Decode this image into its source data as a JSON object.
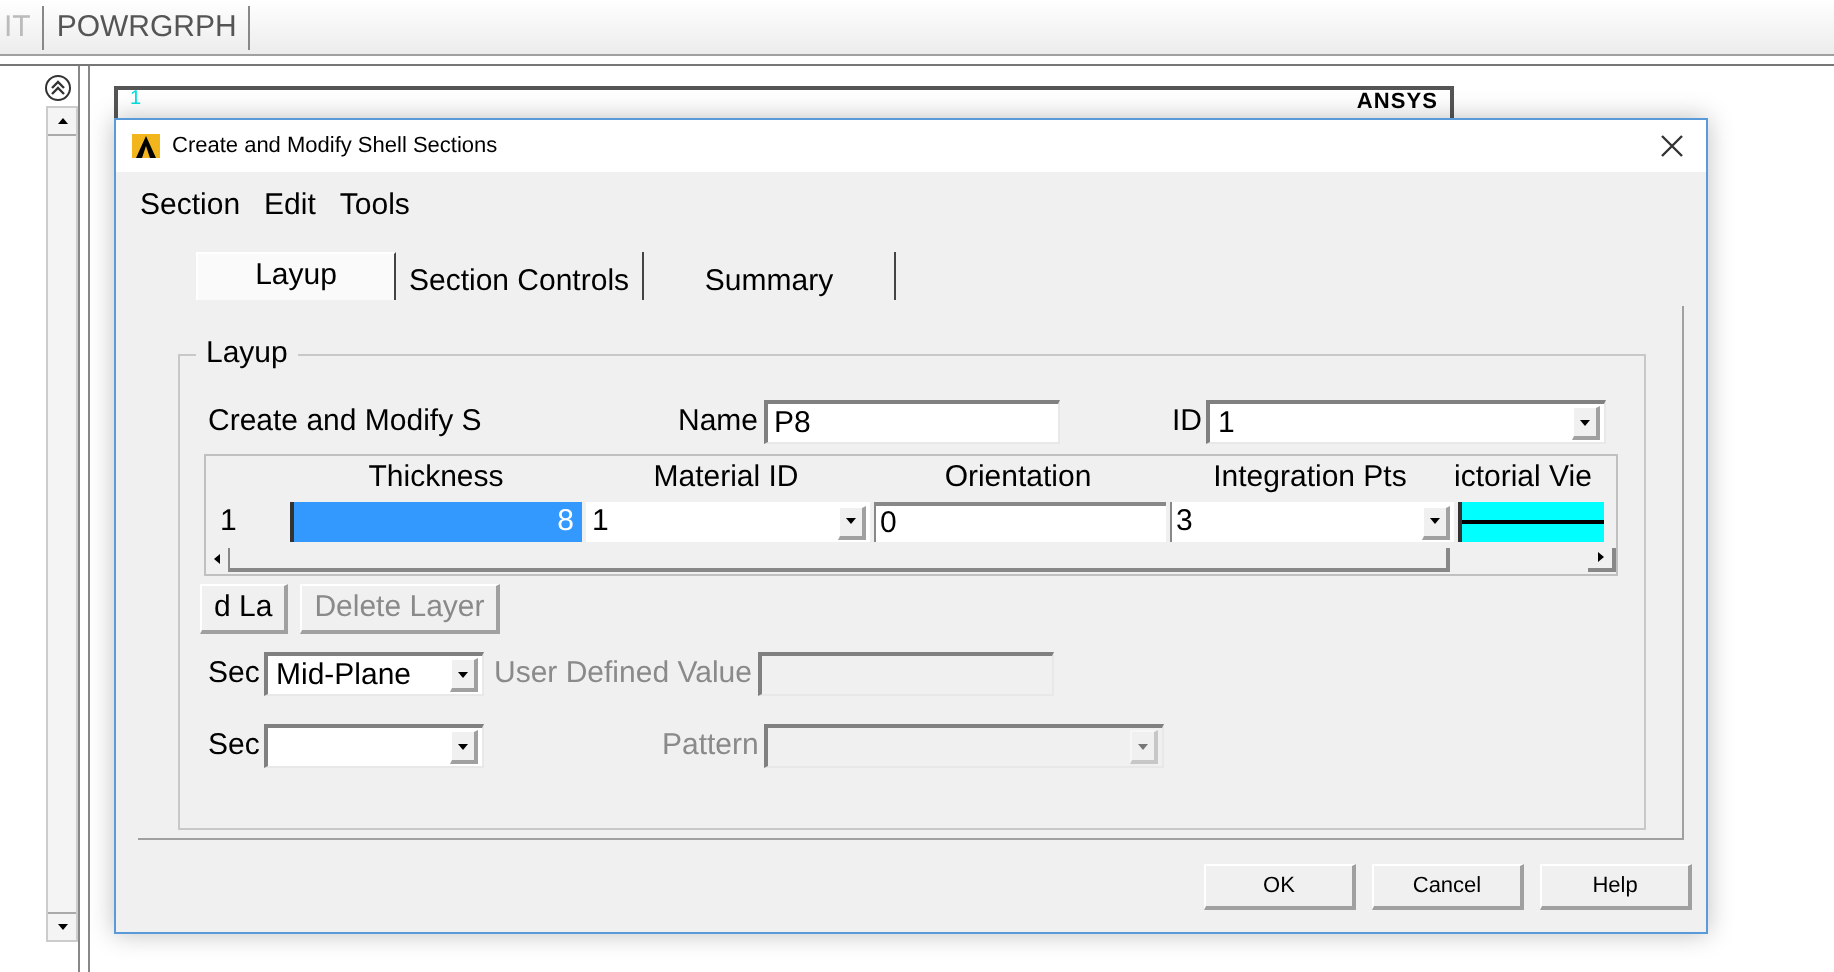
{
  "top_tabs": [
    "IT",
    "POWRGRPH"
  ],
  "graphics": {
    "viewport_number": "1",
    "logo": "ANSYS"
  },
  "dialog": {
    "title": "Create and Modify Shell Sections",
    "menu": [
      "Section",
      "Edit",
      "Tools"
    ],
    "tabs": [
      {
        "label": "Layup",
        "selected": true
      },
      {
        "label": "Section Controls",
        "selected": false
      },
      {
        "label": "Summary",
        "selected": false
      }
    ],
    "group": {
      "title": "Layup",
      "heading": "Create and Modify S",
      "name": {
        "label": "Name",
        "value": "P8"
      },
      "id": {
        "label": "ID",
        "value": "1"
      },
      "layers": {
        "columns": [
          "Thickness",
          "Material ID",
          "Orientation",
          "Integration Pts",
          "ictorial Vie"
        ],
        "rows": [
          {
            "number": "1",
            "thickness": "8",
            "thickness_selected": true,
            "material_id": "1",
            "orientation": "0",
            "integration_pts": "3",
            "color": "#00ffff"
          }
        ]
      },
      "layer_buttons": [
        {
          "label": "d La",
          "disabled": false
        },
        {
          "label": "Delete Layer",
          "disabled": true
        }
      ],
      "offset": {
        "label": "Sec",
        "value": "Mid-Plane"
      },
      "user_value": {
        "label": "User Defined Value",
        "disabled": true
      },
      "integration": {
        "label": "Sec"
      },
      "pattern": {
        "label": "Pattern",
        "disabled": true
      }
    },
    "buttons": [
      "OK",
      "Cancel",
      "Help"
    ]
  }
}
